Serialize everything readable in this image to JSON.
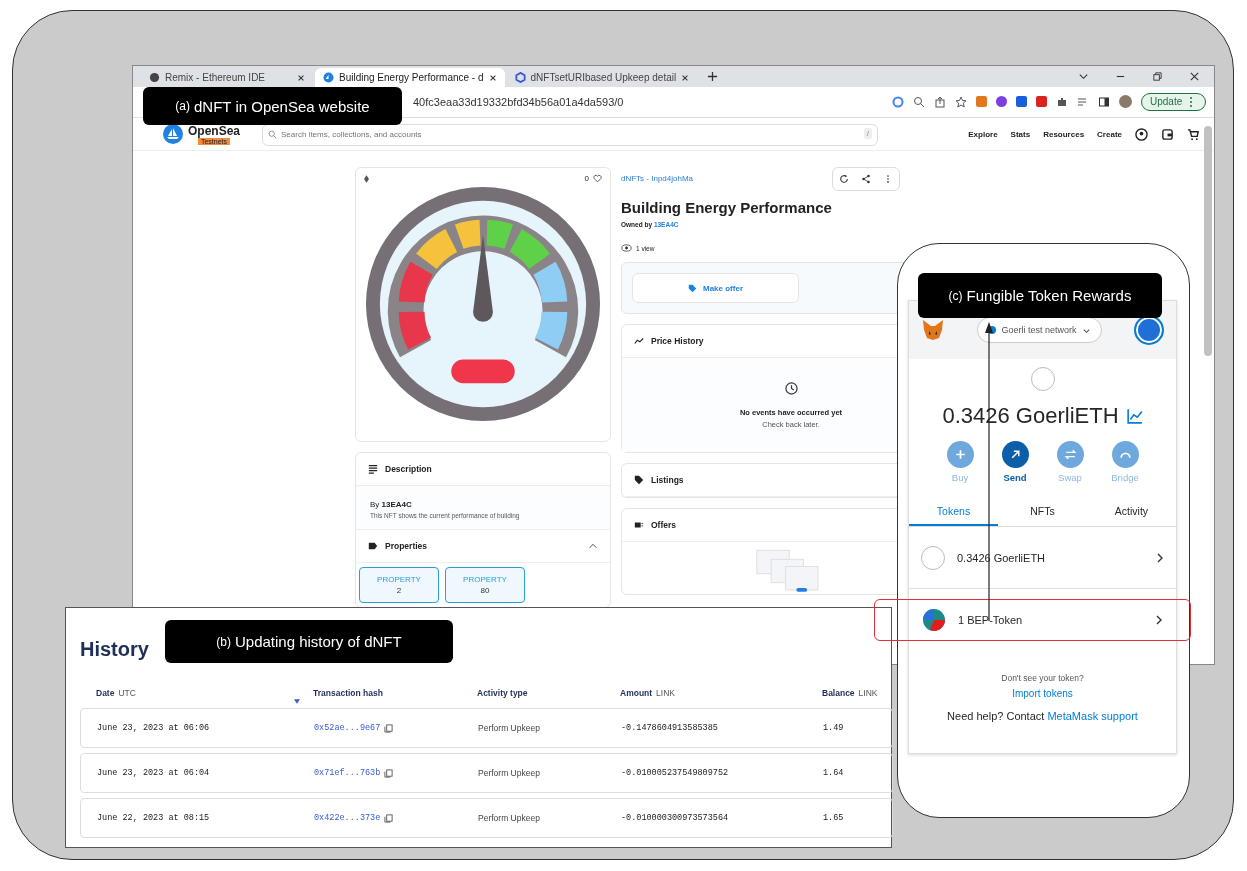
{
  "callouts": [
    {
      "tag": "(a)",
      "text": "dNFT in OpenSea website"
    },
    {
      "tag": "(b)",
      "text": "Updating history of dNFT"
    },
    {
      "tag": "(c)",
      "text": "Fungible Token Rewards"
    }
  ],
  "browser": {
    "tabs": [
      {
        "title": "Remix - Ethereum IDE",
        "selected": false,
        "kind": "remix"
      },
      {
        "title": "Building Energy Performance - d",
        "selected": true,
        "kind": "opensea"
      },
      {
        "title": "dNFTsetURIbased Upkeep detail",
        "selected": false,
        "kind": "chainlink"
      }
    ],
    "address": "40fc3eaa33d19332bfd34b56a01a4da593/0",
    "update_button": "Update"
  },
  "opensea": {
    "logo": "OpenSea",
    "badge": "Testnets",
    "search": {
      "placeholder": "Search items, collections, and accounts",
      "shortcut": "/"
    },
    "nav": [
      "Explore",
      "Stats",
      "Resources",
      "Create"
    ],
    "likes": "0",
    "collection": "dNFTs - Inpd4johMa",
    "title": "Building Energy Performance",
    "owned_label": "Owned by",
    "owner": "13EA4C",
    "views": "1 view",
    "make_offer": "Make offer",
    "price_history": {
      "title": "Price History",
      "empty_title": "No events have occurred yet",
      "empty_hint": "Check back later."
    },
    "listings": "Listings",
    "offers": "Offers",
    "description": {
      "title": "Description",
      "by_label": "By",
      "by": "13EA4C",
      "text": "This NFT shows the current performance of building"
    },
    "properties": {
      "title": "Properties",
      "expanded": true,
      "items": [
        {
          "type": "PROPERTY",
          "value": "2"
        },
        {
          "type": "PROPERTY",
          "value": "80"
        }
      ]
    }
  },
  "history": {
    "title": "History",
    "columns": [
      {
        "label": "Date",
        "unit": "UTC"
      },
      {
        "label": "Transaction hash"
      },
      {
        "label": "Activity type"
      },
      {
        "label": "Amount",
        "unit": "LINK"
      },
      {
        "label": "Balance",
        "unit": "LINK"
      }
    ],
    "rows": [
      {
        "date": "June 23, 2023 at 06:06",
        "hash": "0x52ae...9e67",
        "activity": "Perform Upkeep",
        "amount": "-0.1478604913585385",
        "balance": "1.49"
      },
      {
        "date": "June 23, 2023 at 06:04",
        "hash": "0x71ef...763b",
        "activity": "Perform Upkeep",
        "amount": "-0.010005237549809752",
        "balance": "1.64"
      },
      {
        "date": "June 22, 2023 at 08:15",
        "hash": "0x422e...373e",
        "activity": "Perform Upkeep",
        "amount": "-0.010000300973573564",
        "balance": "1.65"
      }
    ]
  },
  "wallet": {
    "network": "Goerli test network",
    "balance": "0.3426 GoerliETH",
    "actions": [
      {
        "label": "Buy",
        "disabled": true,
        "kind": "plus"
      },
      {
        "label": "Send",
        "disabled": false,
        "kind": "send"
      },
      {
        "label": "Swap",
        "disabled": true,
        "kind": "swap"
      },
      {
        "label": "Bridge",
        "disabled": true,
        "kind": "bridge"
      }
    ],
    "tabs": [
      {
        "label": "Tokens",
        "selected": true
      },
      {
        "label": "NFTs",
        "selected": false
      },
      {
        "label": "Activity",
        "selected": false
      }
    ],
    "tokens": [
      {
        "label": "0.3426 GoerliETH",
        "kind": "empty",
        "highlighted": false
      },
      {
        "label": "1 BEP-Token",
        "kind": "logo",
        "highlighted": true
      }
    ],
    "hint": "Don't see your token?",
    "import_link": "Import tokens",
    "help_text": "Need help? Contact",
    "support_link": "MetaMask support"
  }
}
